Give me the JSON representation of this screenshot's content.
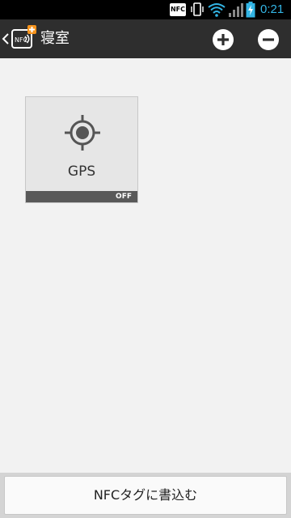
{
  "status_bar": {
    "nfc_label": "NFC",
    "time": "0:21",
    "time_color": "#33b5e5",
    "icons": [
      "nfc-icon",
      "vibrate-icon",
      "wifi-icon",
      "signal-icon",
      "battery-charging-icon"
    ]
  },
  "action_bar": {
    "title": "寝室",
    "logo_label": "NFC",
    "icons": [
      "back-caret-icon",
      "nfc-app-logo-icon",
      "plus-icon",
      "minus-icon"
    ]
  },
  "tiles": [
    {
      "label": "GPS",
      "status": "OFF",
      "icon": "gps-icon"
    }
  ],
  "footer": {
    "write_button_label": "NFCタグに書込む"
  }
}
